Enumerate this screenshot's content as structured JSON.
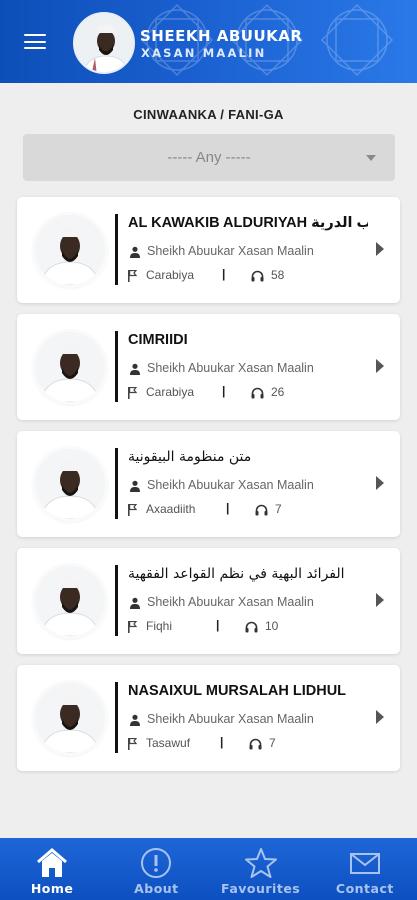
{
  "header": {
    "title": "SHEEKH ABUUKAR",
    "subtitle": "XASAN MAALIN"
  },
  "filter": {
    "label": "CINWAANKA / FANI-GA",
    "selected": "----- Any -----"
  },
  "items": [
    {
      "title": "AL KAWAKIB ALDURIYAH الكواكب الدرية",
      "author": "Sheikh Abuukar Xasan Maalin",
      "category": "Carabiya",
      "plays": "58"
    },
    {
      "title": "CIMRIIDI",
      "author": "Sheikh Abuukar Xasan Maalin",
      "category": "Carabiya",
      "plays": "26"
    },
    {
      "title": "متن منظومة البيقونية",
      "author": "Sheikh Abuukar Xasan Maalin",
      "category": "Axaadiith",
      "plays": "7"
    },
    {
      "title": "الفرائد البهية في نظم القواعد الفقهية",
      "author": "Sheikh Abuukar Xasan Maalin",
      "category": "Fiqhi",
      "plays": "10"
    },
    {
      "title": "NASAIXUL MURSALAH LIDHUL",
      "author": "Sheikh Abuukar Xasan Maalin",
      "category": "Tasawuf",
      "plays": "7"
    }
  ],
  "nav": [
    {
      "label": "Home",
      "icon": "home-icon"
    },
    {
      "label": "About",
      "icon": "info-icon"
    },
    {
      "label": "Favourites",
      "icon": "star-icon"
    },
    {
      "label": "Contact",
      "icon": "mail-icon"
    }
  ],
  "colors": {
    "primary": "#1a5fd0",
    "nav_inactive": "#a9c3ef"
  }
}
